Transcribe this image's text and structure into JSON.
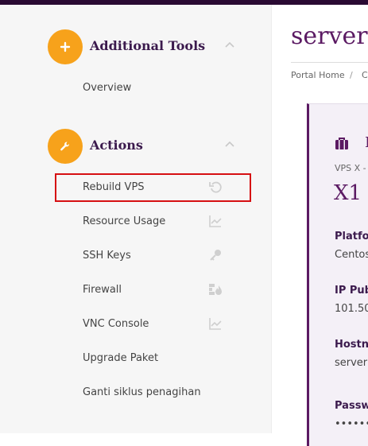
{
  "sidebar": {
    "sections": [
      {
        "title": "Additional Tools",
        "icon": "plus-icon",
        "items": [
          {
            "label": "Overview"
          }
        ]
      },
      {
        "title": "Actions",
        "icon": "wrench-icon",
        "items": [
          {
            "label": "Rebuild VPS",
            "icon": "refresh-icon"
          },
          {
            "label": "Resource Usage",
            "icon": "chart-icon"
          },
          {
            "label": "SSH Keys",
            "icon": "key-icon"
          },
          {
            "label": "Firewall",
            "icon": "firewall-icon"
          },
          {
            "label": "VNC Console",
            "icon": "chart-icon"
          },
          {
            "label": "Upgrade Paket"
          },
          {
            "label": "Ganti siklus penagihan"
          }
        ]
      }
    ]
  },
  "main": {
    "page_title": "server",
    "breadcrumb": {
      "home": "Portal Home",
      "sep": "/",
      "next": "Cl"
    },
    "card": {
      "product_group": "VPS X -",
      "product_name": "X1",
      "heading_initial": "I",
      "fields": [
        {
          "label": "Platfor",
          "value": "Centos"
        },
        {
          "label": "IP Pub",
          "value": "101.50"
        },
        {
          "label": "Hostna",
          "value": "server"
        },
        {
          "label": "Passw",
          "value": "••••••••"
        }
      ]
    }
  },
  "colors": {
    "accent": "#f7a21b",
    "brand": "#5b1a63",
    "highlight": "#d60f12"
  }
}
